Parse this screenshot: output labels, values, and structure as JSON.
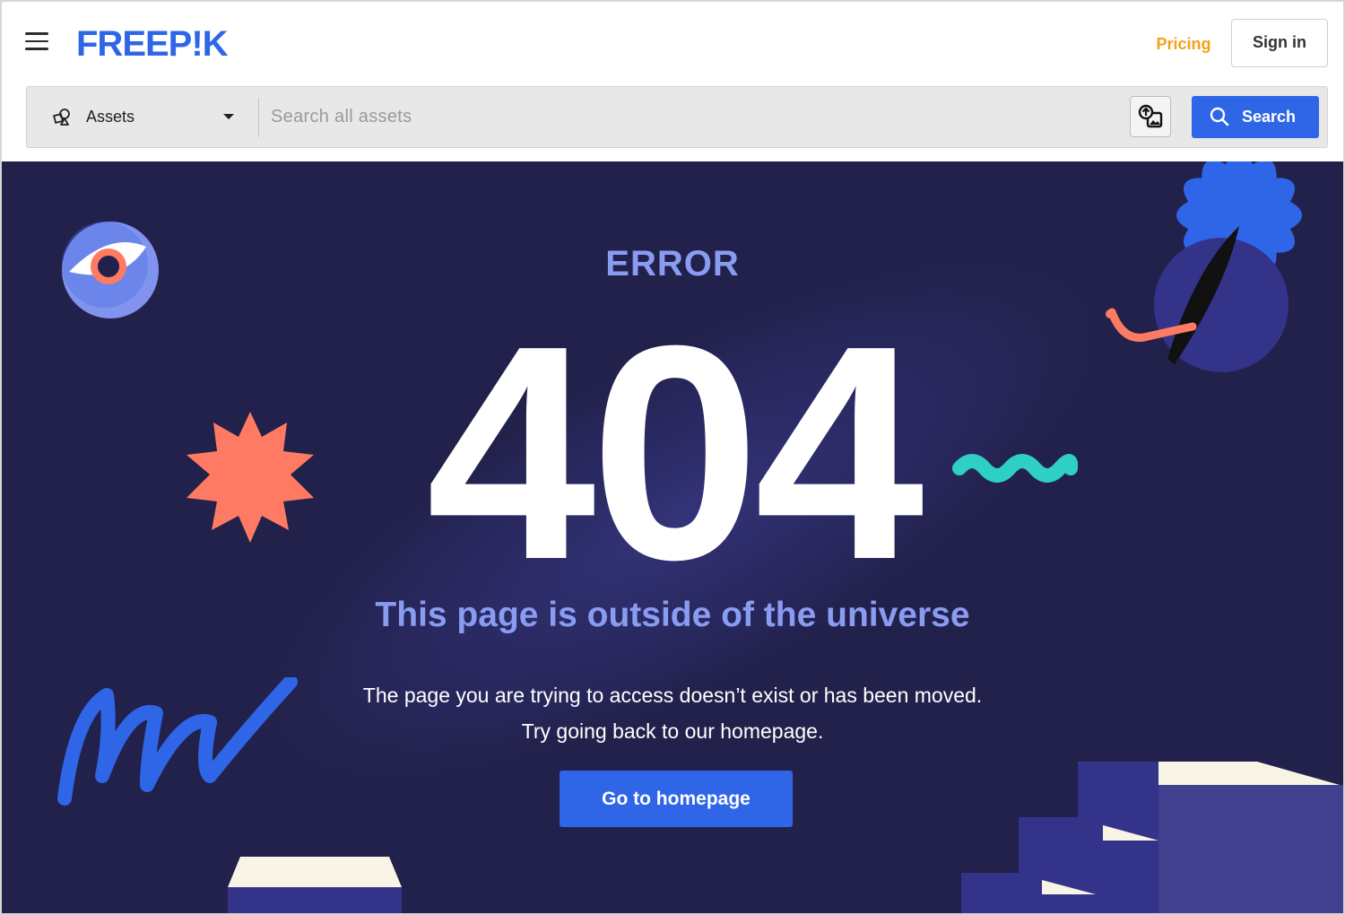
{
  "header": {
    "brand": "FREEPIK",
    "pricing_label": "Pricing",
    "signin_label": "Sign in"
  },
  "search": {
    "category_label": "Assets",
    "placeholder": "Search all assets",
    "button_label": "Search"
  },
  "error": {
    "label": "ERROR",
    "code": "404",
    "headline": "This page is outside of the universe",
    "line1": "The page you are trying to access doesn’t exist or has been moved.",
    "line2": "Try going back to our homepage.",
    "button_label": "Go to homepage"
  },
  "colors": {
    "brand_blue": "#2f66e8",
    "pricing_orange": "#f5a11b",
    "hero_bg": "#22214b",
    "accent_lavender": "#8a9cf2",
    "coral": "#ff7a62",
    "teal": "#2ed0c4"
  },
  "icons": [
    "menu-icon",
    "assets-icon",
    "caret-down-icon",
    "image-search-icon",
    "search-icon"
  ]
}
